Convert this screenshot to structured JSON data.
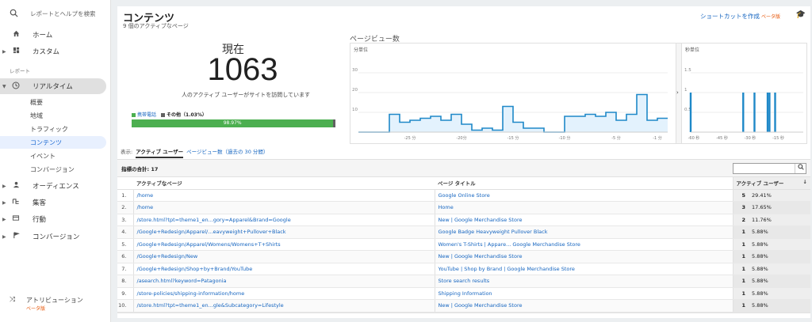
{
  "sidebar": {
    "search_placeholder": "レポートとヘルプを検索",
    "home": "ホーム",
    "custom": "カスタム",
    "section_report": "レポート",
    "realtime": "リアルタイム",
    "realtime_items": [
      "概要",
      "地域",
      "トラフィック",
      "コンテンツ",
      "イベント",
      "コンバージョン"
    ],
    "audience": "オーディエンス",
    "acquisition": "集客",
    "behavior": "行動",
    "conversion": "コンバージョン",
    "attribution": "アトリビューション",
    "attribution_beta": "ベータ版"
  },
  "header": {
    "title": "コンテンツ",
    "subtitle": "9 個のアクティブなページ",
    "shortcut": "ショートカットを作成",
    "shortcut_beta": "ベータ版"
  },
  "summary": {
    "now_label": "現在",
    "count": "1063",
    "active_text": "人のアクティブ ユーザーがサイトを訪問しています",
    "legend_mobile": "携帯電話",
    "legend_other": "その他（1.03%）",
    "mobile_percent": "98.97%",
    "mobile_fraction": 0.9897,
    "colors": {
      "mobile": "#4caf50",
      "other": "#616161"
    }
  },
  "pageviews": {
    "title": "ページビュー数",
    "per_minute_label": "分単位",
    "per_second_label": "秒単位"
  },
  "chart_data": [
    {
      "type": "bar",
      "title": "",
      "xlabel": "",
      "ylabel": "",
      "ylim": [
        0,
        40
      ],
      "yticks": [
        10,
        20,
        30
      ],
      "x": [
        -30,
        -29,
        -28,
        -27,
        -26,
        -25,
        -24,
        -23,
        -22,
        -21,
        -20,
        -19,
        -18,
        -17,
        -16,
        -15,
        -14,
        -13,
        -12,
        -11,
        -10,
        -9,
        -8,
        -7,
        -6,
        -5,
        -4,
        -3,
        -2,
        -1
      ],
      "xtick_labels": [
        "-25 分",
        "-20分",
        "-15 分",
        "-10 分",
        "-5 分",
        "-1 分"
      ],
      "values": [
        0,
        0,
        0,
        9,
        5,
        6,
        7,
        8,
        6,
        9,
        4,
        1,
        2,
        1,
        13,
        5,
        2,
        2,
        0,
        0,
        8,
        8,
        9,
        8,
        10,
        6,
        9,
        19,
        6,
        7
      ],
      "color": "#1e88c8"
    },
    {
      "type": "bar",
      "title": "",
      "xlabel": "",
      "ylabel": "",
      "ylim": [
        0,
        2
      ],
      "yticks": [
        0.5,
        1,
        1.5
      ],
      "xtick_labels": [
        "-60 秒",
        "-45 秒",
        "-30 秒",
        "-15 秒"
      ],
      "x": [
        -60,
        -32,
        -26,
        -19,
        -18,
        -15
      ],
      "values": [
        1,
        1,
        1,
        1,
        1,
        1
      ],
      "color": "#1e88c8"
    }
  ],
  "tabs": {
    "label": "表示:",
    "active": "アクティブ ユーザー",
    "link": "ページビュー数（過去の 30 分間）"
  },
  "table": {
    "total": "指標の合計: 17",
    "headers": [
      "アクティブなページ",
      "ページ タイトル",
      "アクティブ ユーザー"
    ],
    "rows": [
      {
        "n": "1.",
        "page": "/home",
        "title": "Google Online Store",
        "val": "5",
        "pct": "29.41%"
      },
      {
        "n": "2.",
        "page": "/home",
        "title": "Home",
        "val": "3",
        "pct": "17.65%"
      },
      {
        "n": "3.",
        "page": "/store.html?tpt=theme1_en...gory=Apparel&Brand=Google",
        "title": "New | Google Merchandise Store",
        "val": "2",
        "pct": "11.76%"
      },
      {
        "n": "4.",
        "page": "/Google+Redesign/Apparel/...eavyweight+Pullover+Black",
        "title": "Google Badge Heavyweight Pullover Black",
        "val": "1",
        "pct": "5.88%"
      },
      {
        "n": "5.",
        "page": "/Google+Redesign/Apparel/Womens/Womens+T+Shirts",
        "title": "Women's T-Shirts | Appare... Google Merchandise Store",
        "val": "1",
        "pct": "5.88%"
      },
      {
        "n": "6.",
        "page": "/Google+Redesign/New",
        "title": "New | Google Merchandise Store",
        "val": "1",
        "pct": "5.88%"
      },
      {
        "n": "7.",
        "page": "/Google+Redesign/Shop+by+Brand/YouTube",
        "title": "YouTube | Shop by Brand | Google Merchandise Store",
        "val": "1",
        "pct": "5.88%"
      },
      {
        "n": "8.",
        "page": "/asearch.html?keyword=Patagonia",
        "title": "Store search results",
        "val": "1",
        "pct": "5.88%"
      },
      {
        "n": "9.",
        "page": "/store-policies/shipping-information/home",
        "title": "Shipping Information",
        "val": "1",
        "pct": "5.88%"
      },
      {
        "n": "10.",
        "page": "/store.html?tpt=theme1_en...gle&Subcategory=Lifestyle",
        "title": "New | Google Merchandise Store",
        "val": "1",
        "pct": "5.88%"
      }
    ]
  }
}
